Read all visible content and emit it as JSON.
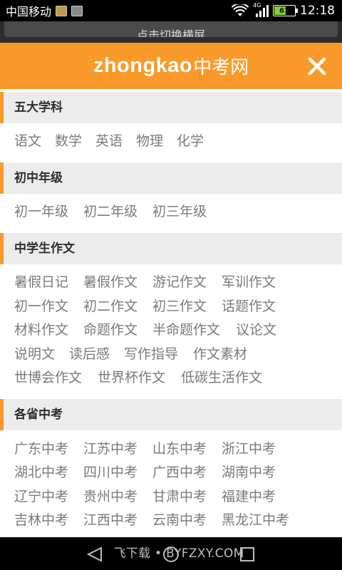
{
  "status_bar": {
    "carrier": "中国移动",
    "network": "4G",
    "battery": "61",
    "battery_level": 0.61,
    "time": "12:18",
    "icons": [
      "sim-app-icon",
      "image-icon",
      "wifi-icon",
      "signal-icon",
      "battery-icon"
    ]
  },
  "rotate_banner": {
    "label": "点击切换横屏"
  },
  "header": {
    "logo_en": "zhongkao",
    "logo_cn": "中考网",
    "close_icon": "close-icon",
    "accent_color": "#f99a2a"
  },
  "sections": [
    {
      "title": "五大学科",
      "links": [
        "语文",
        "数学",
        "英语",
        "物理",
        "化学"
      ]
    },
    {
      "title": "初中年级",
      "links": [
        "初一年级",
        "初二年级",
        "初三年级"
      ]
    },
    {
      "title": "中学生作文",
      "links": [
        "暑假日记",
        "暑假作文",
        "游记作文",
        "军训作文",
        "初一作文",
        "初二作文",
        "初三作文",
        "话题作文",
        "材料作文",
        "命题作文",
        "半命题作文",
        "议论文",
        "说明文",
        "读后感",
        "写作指导",
        "作文素材",
        "世博会作文",
        "世界杯作文",
        "低碳生活作文"
      ]
    },
    {
      "title": "各省中考",
      "links": [
        "广东中考",
        "江苏中考",
        "山东中考",
        "浙江中考",
        "湖北中考",
        "四川中考",
        "广西中考",
        "湖南中考",
        "辽宁中考",
        "贵州中考",
        "甘肃中考",
        "福建中考",
        "吉林中考",
        "江西中考",
        "云南中考",
        "黑龙江中考"
      ]
    }
  ],
  "nav_bar": {
    "watermark": "飞下载 • BYFZXY.COM",
    "buttons": [
      "back-icon",
      "home-icon",
      "recent-apps-icon"
    ]
  }
}
